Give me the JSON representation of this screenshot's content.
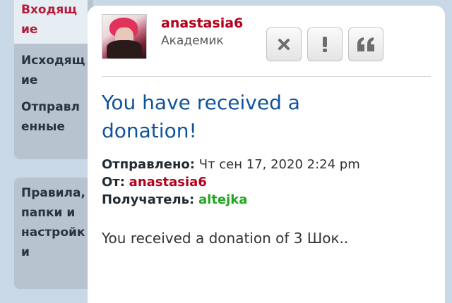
{
  "sidebar": {
    "folders": [
      {
        "label": "Входящие",
        "active": true
      },
      {
        "label": "Исходящие",
        "active": false
      },
      {
        "label": "Отправленные",
        "active": false
      }
    ],
    "settings_label": "Правила, папки и настройки"
  },
  "post": {
    "author": {
      "username": "anastasia6",
      "rank": "Академик"
    },
    "actions": {
      "delete_icon": "close-icon",
      "report_icon": "exclamation-icon",
      "quote_icon": "quote-icon"
    },
    "subject": "You have received a donation!",
    "sent_label": "Отправлено:",
    "sent_value": "Чт сен 17, 2020 2:24 pm",
    "from_label": "От:",
    "from_value": "anastasia6",
    "to_label": "Получатель:",
    "to_value": "altejka",
    "body": "You received a donation of 3 Шок.."
  },
  "colors": {
    "active_nav": "#b41c3b",
    "username": "#b3001b",
    "subject": "#10539c",
    "recipient": "#22a521"
  }
}
